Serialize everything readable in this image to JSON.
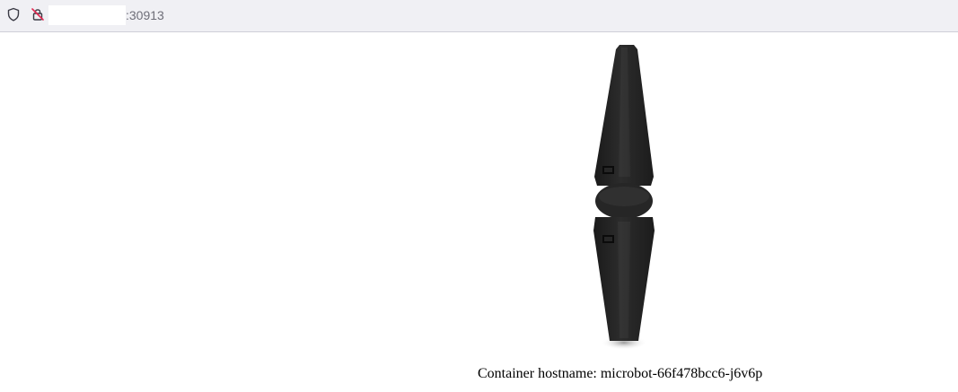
{
  "browser": {
    "url_visible_suffix": ":30913",
    "icons": {
      "site_info": "shield-icon",
      "connection": "insecure-lock-icon"
    }
  },
  "page": {
    "image": "microbot-robot",
    "hostname_line": "Container hostname: microbot-66f478bcc6-j6v6p"
  }
}
